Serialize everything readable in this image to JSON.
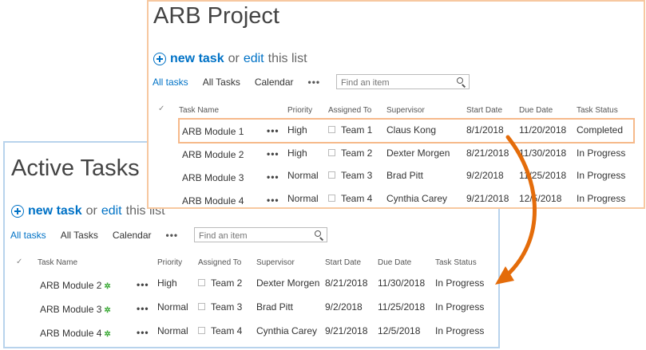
{
  "back": {
    "title": "Active Tasks",
    "new_task": "new task",
    "or": "or",
    "edit": "edit",
    "this_list": "this list",
    "views": [
      "All tasks",
      "All Tasks",
      "Calendar"
    ],
    "more": "•••",
    "search_placeholder": "Find an item",
    "columns": [
      "Task Name",
      "Priority",
      "Assigned To",
      "Supervisor",
      "Start Date",
      "Due Date",
      "Task Status"
    ],
    "rows": [
      {
        "name": "ARB Module 2",
        "priority": "High",
        "assigned": "Team 2",
        "supervisor": "Dexter Morgen",
        "start": "8/21/2018",
        "due": "11/30/2018",
        "status": "In Progress"
      },
      {
        "name": "ARB Module 3",
        "priority": "Normal",
        "assigned": "Team 3",
        "supervisor": "Brad Pitt",
        "start": "9/2/2018",
        "due": "11/25/2018",
        "status": "In Progress"
      },
      {
        "name": "ARB Module 4",
        "priority": "Normal",
        "assigned": "Team 4",
        "supervisor": "Cynthia Carey",
        "start": "9/21/2018",
        "due": "12/5/2018",
        "status": "In Progress"
      }
    ]
  },
  "front": {
    "title": "ARB Project",
    "new_task": "new task",
    "or": "or",
    "edit": "edit",
    "this_list": "this list",
    "views": [
      "All tasks",
      "All Tasks",
      "Calendar"
    ],
    "more": "•••",
    "search_placeholder": "Find an item",
    "columns": [
      "Task Name",
      "Priority",
      "Assigned To",
      "Supervisor",
      "Start Date",
      "Due Date",
      "Task Status"
    ],
    "rows": [
      {
        "name": "ARB Module 1",
        "priority": "High",
        "assigned": "Team 1",
        "supervisor": "Claus Kong",
        "start": "8/1/2018",
        "due": "11/20/2018",
        "status": "Completed"
      },
      {
        "name": "ARB Module 2",
        "priority": "High",
        "assigned": "Team 2",
        "supervisor": "Dexter Morgen",
        "start": "8/21/2018",
        "due": "11/30/2018",
        "status": "In Progress"
      },
      {
        "name": "ARB Module 3",
        "priority": "Normal",
        "assigned": "Team 3",
        "supervisor": "Brad Pitt",
        "start": "9/2/2018",
        "due": "11/25/2018",
        "status": "In Progress"
      },
      {
        "name": "ARB Module 4",
        "priority": "Normal",
        "assigned": "Team 4",
        "supervisor": "Cynthia Carey",
        "start": "9/21/2018",
        "due": "12/5/2018",
        "status": "In Progress"
      }
    ]
  },
  "icons": {
    "new_item": "new-item-icon",
    "checkmark": "checkmark-icon",
    "search": "search-icon",
    "plus": "plus-circle-icon",
    "arrow": "curved-arrow-icon"
  },
  "colors": {
    "link": "#0072c6",
    "arrow": "#e46c0a",
    "front_border": "#f7c8a0",
    "back_border": "#b8d3ec",
    "new_icon": "#3aa935"
  }
}
